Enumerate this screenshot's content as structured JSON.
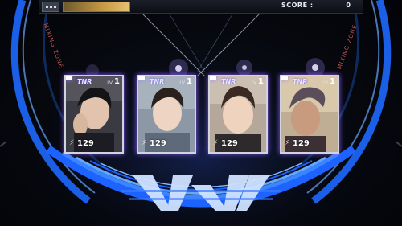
{
  "hud": {
    "score_label": "SCORE :",
    "score_value": "0",
    "gauge_color": "#c79a45"
  },
  "zone": {
    "left_label": "MIXING ZONE",
    "right_label": "MIXING ZONE",
    "ring_color": "#1f6fff",
    "accent_color": "#7b3cff"
  },
  "cards": [
    {
      "badge": "TNR",
      "lv_label": "LV",
      "level": "1",
      "power": "129",
      "icon": "lightning-icon"
    },
    {
      "badge": "TNR",
      "lv_label": "LV",
      "level": "1",
      "power": "129",
      "icon": "lightning-icon"
    },
    {
      "badge": "TNR",
      "lv_label": "LV",
      "level": "1",
      "power": "129",
      "icon": "lightning-icon"
    },
    {
      "badge": "TNR",
      "lv_label": "LV",
      "level": "1",
      "power": "129",
      "icon": "lightning-icon"
    }
  ]
}
